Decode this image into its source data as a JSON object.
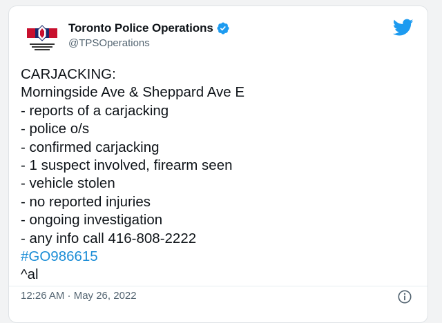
{
  "tweet": {
    "author_name": "Toronto Police Operations",
    "handle": "@TPSOperations",
    "lines": [
      "CARJACKING:",
      "Morningside Ave & Sheppard Ave E",
      "- reports of a carjacking",
      "- police o/s",
      "- confirmed carjacking",
      "- 1 suspect involved, firearm seen",
      "- vehicle stolen",
      "- no reported injuries",
      "- ongoing investigation",
      "- any info call 416-808-2222"
    ],
    "hashtag": "#GO986615",
    "signoff": "^al",
    "timestamp": "12:26 AM · May 26, 2022",
    "avatar_text": "TORONTO POLICE OPERATIONS CENTRE"
  },
  "icons": {
    "verified": "verified-badge-icon",
    "brand": "twitter-bird-icon",
    "info": "info-icon"
  },
  "colors": {
    "verified": "#1d9bf0",
    "brand": "#1d9bf0",
    "hashtag": "#1b8dd6",
    "muted": "#536471"
  }
}
